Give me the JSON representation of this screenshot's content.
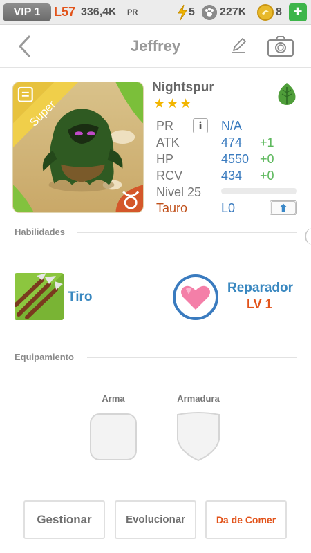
{
  "status_bar": {
    "vip": "VIP 1",
    "level": "L57",
    "pr": "336,4K",
    "pr_suffix": "PR",
    "energy": "5",
    "paws": "227K",
    "coins": "8",
    "add_label": "+"
  },
  "header": {
    "title": "Jeffrey"
  },
  "monster": {
    "name": "Nightspur",
    "stars": "★★★",
    "badge": "Super",
    "element": "leaf-icon",
    "stats": [
      {
        "label": "PR",
        "value": "N/A",
        "bonus": ""
      },
      {
        "label": "ATK",
        "value": "474",
        "bonus": "+1"
      },
      {
        "label": "HP",
        "value": "4550",
        "bonus": "+0"
      },
      {
        "label": "RCV",
        "value": "434",
        "bonus": "+0"
      }
    ],
    "level_label": "Nivel 25",
    "xp_fraction": 0.0,
    "zodiac": "Tauro",
    "zodiac_level": "L0"
  },
  "skills": {
    "section_title": "Habilidades",
    "active": {
      "name": "Tiro"
    },
    "passive": {
      "name": "Reparador",
      "level": "LV 1"
    }
  },
  "equipment": {
    "section_title": "Equipamiento",
    "weapon_label": "Arma",
    "armor_label": "Armadura"
  },
  "actions": {
    "manage": "Gestionar",
    "evolve": "Evolucionar",
    "feed": "Da de Comer"
  },
  "colors": {
    "accent_blue": "#3a7bbf",
    "accent_orange": "#e2531a",
    "bonus_green": "#5cb85c",
    "star_gold": "#f2b500"
  }
}
